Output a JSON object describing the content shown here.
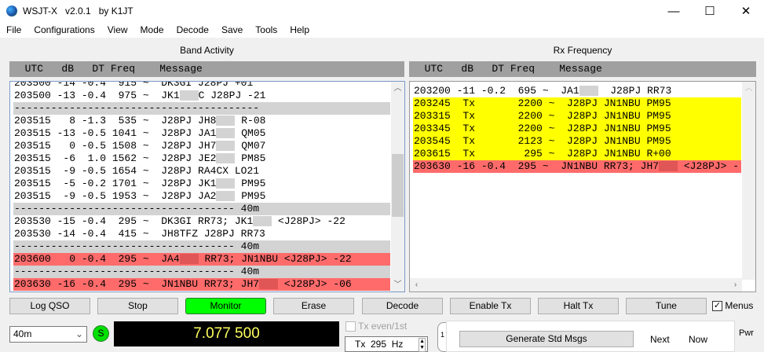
{
  "window": {
    "title": "WSJT-X   v2.0.1   by K1JT",
    "minimize": "—",
    "maximize": "☐",
    "close": "✕"
  },
  "menu": [
    "File",
    "Configurations",
    "View",
    "Mode",
    "Decode",
    "Save",
    "Tools",
    "Help"
  ],
  "band_activity": {
    "label": "Band Activity",
    "header": "  UTC   dB   DT Freq    Message",
    "rows": [
      {
        "s": "",
        "a": "203500 -14 -0.4  915 ~  DK3GI J28PJ +01",
        "b": ""
      },
      {
        "s": "",
        "a": "203500 -13 -0.4  975 ~  JK1",
        "r": 1,
        "b": "C J28PJ -21"
      },
      {
        "s": "sep",
        "a": "----------------------------------------",
        "b": ""
      },
      {
        "s": "",
        "a": "203515   8 -1.3  535 ~  J28PJ JH8",
        "r": 1,
        "b": " R-08"
      },
      {
        "s": "",
        "a": "203515 -13 -0.5 1041 ~  J28PJ JA1",
        "r": 1,
        "b": " QM05"
      },
      {
        "s": "",
        "a": "203515   0 -0.5 1508 ~  J28PJ JH7",
        "r": 1,
        "b": " QM07"
      },
      {
        "s": "",
        "a": "203515  -6  1.0 1562 ~  J28PJ JE2",
        "r": 1,
        "b": " PM85"
      },
      {
        "s": "",
        "a": "203515  -9 -0.5 1654 ~  J28PJ RA4CX LO21",
        "b": ""
      },
      {
        "s": "",
        "a": "203515  -5 -0.2 1701 ~  J28PJ JK1",
        "r": 1,
        "b": " PM95"
      },
      {
        "s": "",
        "a": "203515  -9 -0.5 1953 ~  J28PJ JA2",
        "r": 1,
        "b": " PM95"
      },
      {
        "s": "sep",
        "a": "------------------------------------ 40m",
        "b": ""
      },
      {
        "s": "",
        "a": "203530 -15 -0.4  295 ~  DK3GI RR73; JK1",
        "r": 1,
        "b": " <J28PJ> -22"
      },
      {
        "s": "",
        "a": "203530 -14 -0.4  415 ~  JH8TFZ J28PJ RR73",
        "b": ""
      },
      {
        "s": "sep",
        "a": "------------------------------------ 40m",
        "b": ""
      },
      {
        "s": "red",
        "a": "203600   0 -0.4  295 ~  JA4",
        "r": 1,
        "b": " RR73; JN1NBU <J28PJ> -22"
      },
      {
        "s": "sep",
        "a": "------------------------------------ 40m",
        "b": ""
      },
      {
        "s": "red",
        "a": "203630 -16 -0.4  295 ~  JN1NBU RR73; JH7",
        "r": 1,
        "b": " <J28PJ> -06"
      }
    ]
  },
  "rx_frequency": {
    "label": "Rx Frequency",
    "header": "  UTC   dB   DT Freq    Message",
    "rows": [
      {
        "s": "",
        "a": "203200 -11 -0.2  695 ~  JA1",
        "r": 1,
        "b": "  J28PJ RR73"
      },
      {
        "s": "yel",
        "a": "203245  Tx       2200 ~  J28PJ JN1NBU PM95",
        "b": ""
      },
      {
        "s": "yel",
        "a": "203315  Tx       2200 ~  J28PJ JN1NBU PM95",
        "b": ""
      },
      {
        "s": "yel",
        "a": "203345  Tx       2200 ~  J28PJ JN1NBU PM95",
        "b": ""
      },
      {
        "s": "yel",
        "a": "203545  Tx       2123 ~  J28PJ JN1NBU PM95",
        "b": ""
      },
      {
        "s": "yel",
        "a": "203615  Tx        295 ~  J28PJ JN1NBU R+00",
        "b": ""
      },
      {
        "s": "red",
        "a": "203630 -16 -0.4  295 ~  JN1NBU RR73; JH7",
        "r": 1,
        "b": " <J28PJ> -"
      }
    ]
  },
  "buttons": {
    "log_qso": "Log QSO",
    "stop": "Stop",
    "monitor": "Monitor",
    "erase": "Erase",
    "decode": "Decode",
    "enable_tx": "Enable Tx",
    "halt_tx": "Halt Tx",
    "tune": "Tune",
    "menus": "Menus",
    "menus_checked": true
  },
  "band_select": "40m",
  "s_badge": "S",
  "frequency": "7.077 500",
  "tx_even": {
    "label": "Tx even/1st",
    "checked": false
  },
  "tx_freq": "Tx  295  Hz",
  "tab_label": "1",
  "generate": "Generate Std Msgs",
  "next": "Next",
  "now": "Now",
  "pwr": "Pwr",
  "colors": {
    "monitor_on": "#00ff00",
    "tx_highlight": "#ffff00",
    "my_call_highlight": "#ff6b6b",
    "freq_display_bg": "#000000",
    "freq_display_text": "#ffff60"
  }
}
